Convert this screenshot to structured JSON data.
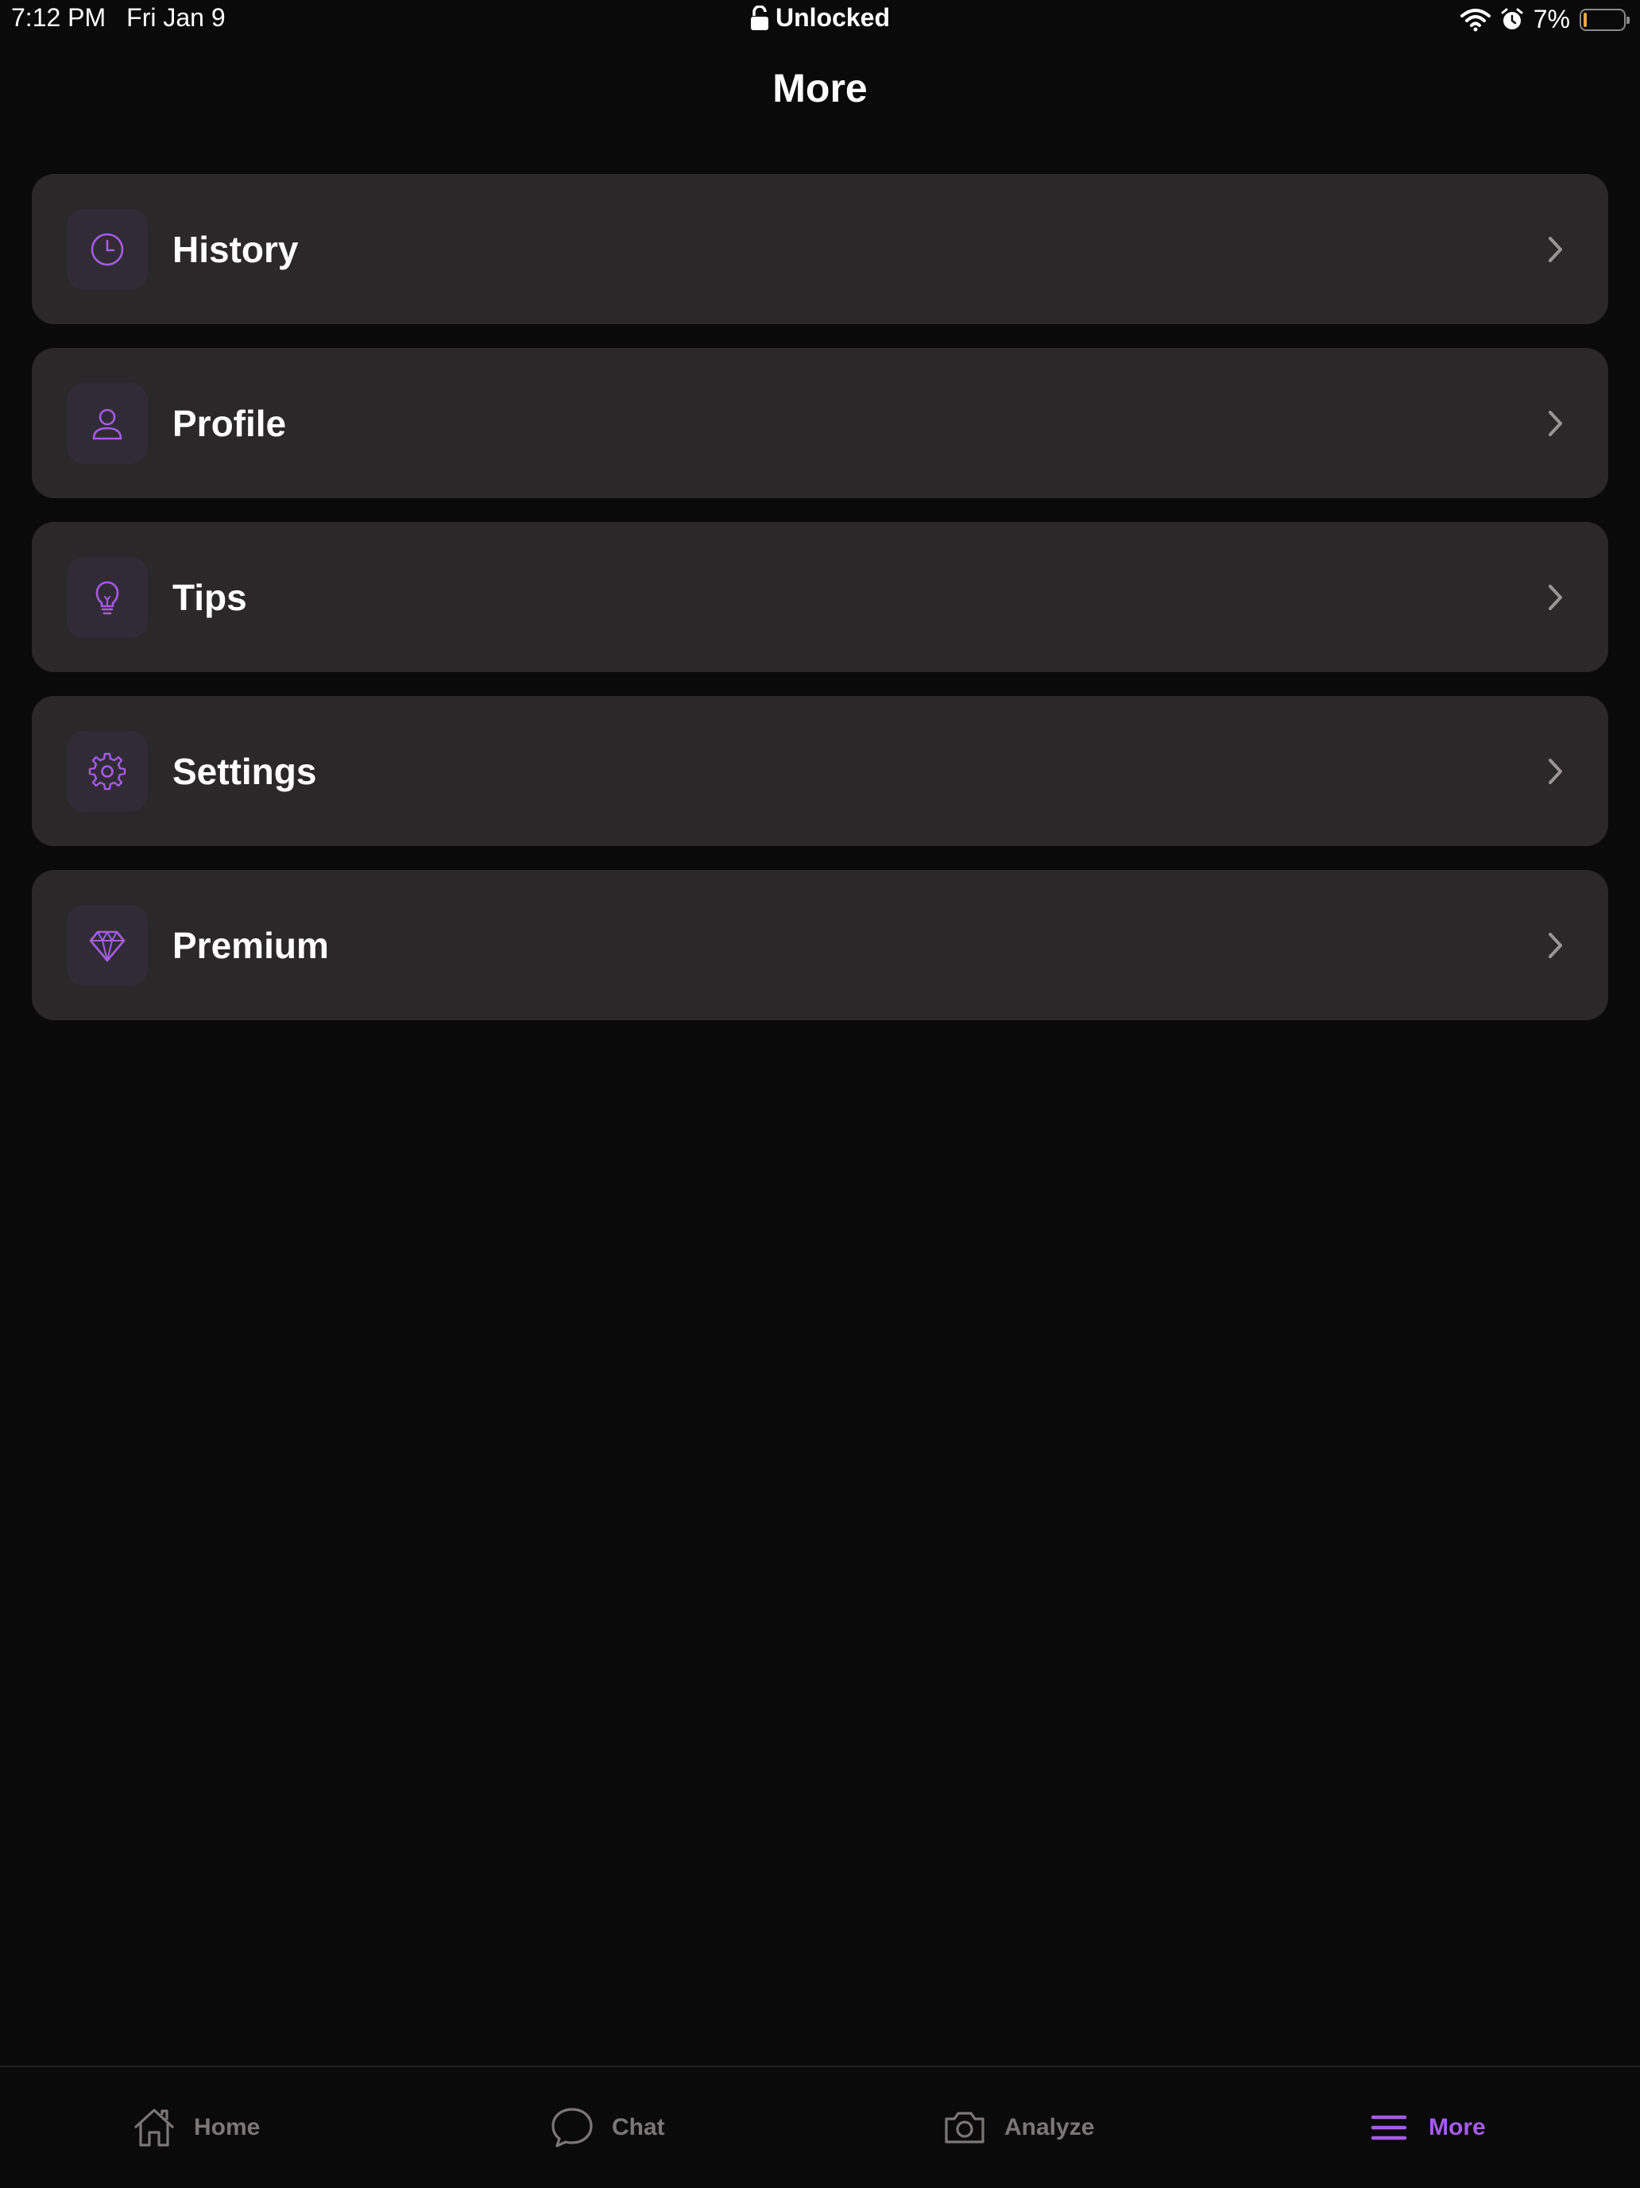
{
  "status_bar": {
    "time": "7:12 PM",
    "date": "Fri Jan 9",
    "lock_status": "Unlocked",
    "battery": "7%",
    "battery_level": 0.07,
    "icons": [
      "lock-open-icon",
      "wifi-icon",
      "alarm-icon",
      "battery-icon"
    ]
  },
  "header": {
    "title": "More"
  },
  "accent_color": "#a55ce6",
  "menu": {
    "items": [
      {
        "label": "History",
        "icon": "clock-icon"
      },
      {
        "label": "Profile",
        "icon": "person-icon"
      },
      {
        "label": "Tips",
        "icon": "lightbulb-icon"
      },
      {
        "label": "Settings",
        "icon": "gear-icon"
      },
      {
        "label": "Premium",
        "icon": "diamond-icon"
      }
    ]
  },
  "tab_bar": {
    "tabs": [
      {
        "label": "Home",
        "icon": "home-icon",
        "active": false
      },
      {
        "label": "Chat",
        "icon": "chat-bubble-icon",
        "active": false
      },
      {
        "label": "Analyze",
        "icon": "camera-icon",
        "active": false
      },
      {
        "label": "More",
        "icon": "menu-icon",
        "active": true
      }
    ]
  }
}
